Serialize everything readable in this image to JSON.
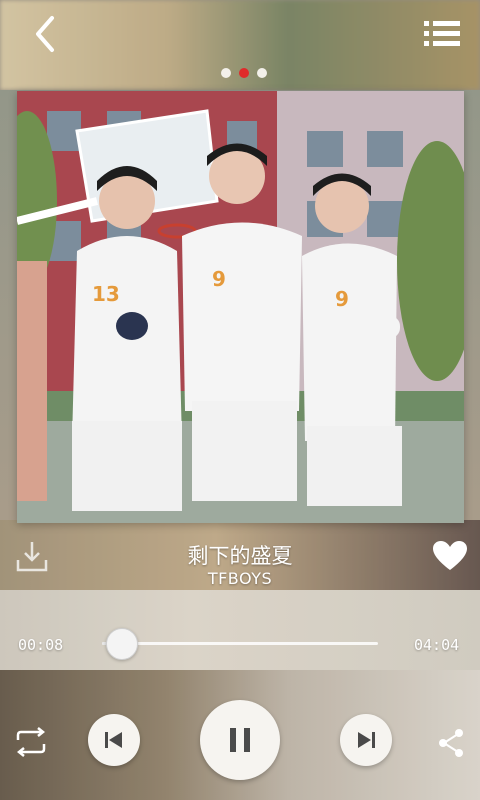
{
  "header": {
    "back_icon": "back-arrow-icon",
    "menu_icon": "list-menu-icon"
  },
  "pager": {
    "count": 3,
    "active_index": 1,
    "active_color": "#e02a2a",
    "inactive_color": "#f3f0ea"
  },
  "song": {
    "title": "剩下的盛夏",
    "artist": "TFBOYS"
  },
  "progress": {
    "current": "00:08",
    "total": "04:04",
    "fraction": 0.033
  },
  "controls": {
    "repeat_icon": "repeat-icon",
    "prev_icon": "previous-icon",
    "play_state_icon": "pause-icon",
    "next_icon": "next-icon",
    "share_icon": "share-icon",
    "download_icon": "download-icon",
    "favorite_icon": "heart-icon"
  },
  "colors": {
    "text": "#ffffff",
    "control_glyph": "#4a4a4a"
  }
}
